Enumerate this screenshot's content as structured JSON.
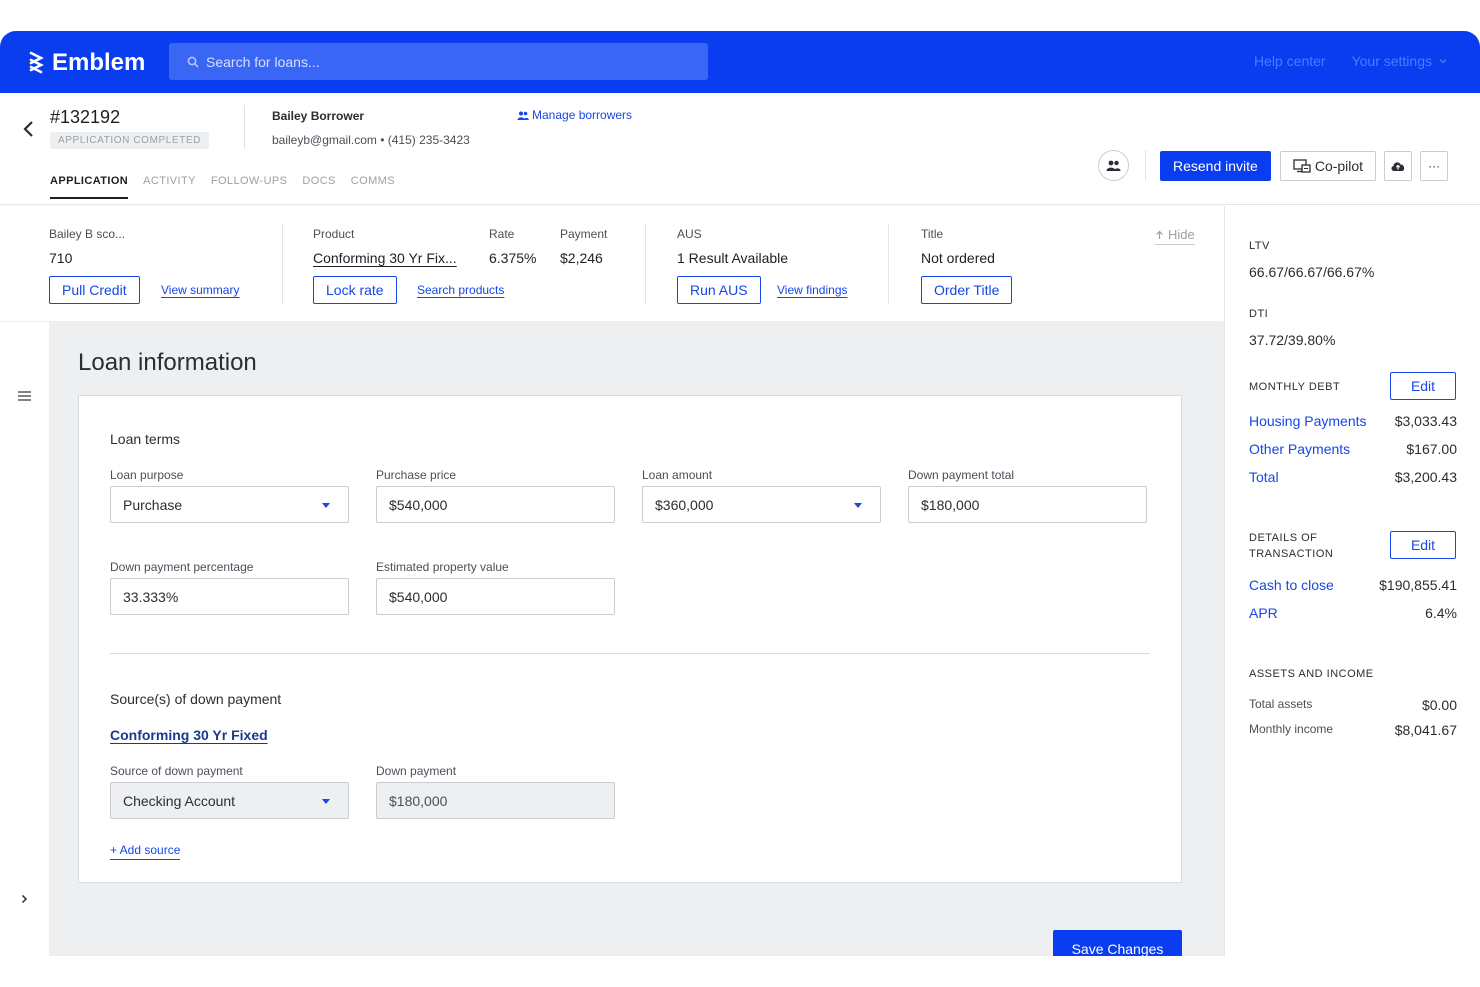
{
  "topbar": {
    "brand": "Emblem",
    "search_placeholder": "Search for loans...",
    "help_center": "Help center",
    "your_settings": "Your settings"
  },
  "header": {
    "loan_id": "#132192",
    "status": "APPLICATION COMPLETED",
    "borrower_name": "Bailey Borrower",
    "borrower_contact": "baileyb@gmail.com • (415) 235-3423",
    "manage_borrowers": "Manage borrowers",
    "tabs": [
      "APPLICATION",
      "ACTIVITY",
      "FOLLOW-UPS",
      "DOCS",
      "COMMS"
    ],
    "resend_invite": "Resend invite",
    "copilot": "Co-pilot",
    "more": "···"
  },
  "summary": {
    "credit": {
      "label": "Bailey B sco...",
      "value": "710",
      "button": "Pull Credit",
      "link": "View summary"
    },
    "product": {
      "label": "Product",
      "value": "Conforming 30 Yr Fix...",
      "button": "Lock rate",
      "link": "Search products"
    },
    "rate": {
      "label": "Rate",
      "value": "6.375%"
    },
    "payment": {
      "label": "Payment",
      "value": "$2,246"
    },
    "aus": {
      "label": "AUS",
      "value": "1 Result Available",
      "button": "Run AUS",
      "link": "View findings"
    },
    "title": {
      "label": "Title",
      "value": "Not ordered",
      "button": "Order Title"
    },
    "hide": "Hide"
  },
  "main": {
    "page_title": "Loan information",
    "loan_terms": {
      "title": "Loan terms",
      "loan_purpose": {
        "label": "Loan purpose",
        "value": "Purchase"
      },
      "purchase_price": {
        "label": "Purchase price",
        "value": "$540,000"
      },
      "loan_amount": {
        "label": "Loan amount",
        "value": "$360,000"
      },
      "down_payment_total": {
        "label": "Down payment total",
        "value": "$180,000"
      },
      "down_payment_pct": {
        "label": "Down payment percentage",
        "value": "33.333%"
      },
      "est_property_value": {
        "label": "Estimated property value",
        "value": "$540,000"
      }
    },
    "sources": {
      "title": "Source(s) of down payment",
      "product_link": "Conforming 30 Yr Fixed",
      "source": {
        "label": "Source of down payment",
        "value": "Checking Account"
      },
      "down_payment": {
        "label": "Down payment",
        "value": "$180,000"
      },
      "add_source": "+ Add source"
    },
    "save": "Save Changes"
  },
  "right_panel": {
    "ltv": {
      "label": "LTV",
      "value": "66.67/66.67/66.67%"
    },
    "dti": {
      "label": "DTI",
      "value": "37.72/39.80%"
    },
    "monthly_debt": {
      "label": "MONTHLY DEBT",
      "edit": "Edit",
      "rows": [
        {
          "k": "Housing Payments",
          "v": "$3,033.43"
        },
        {
          "k": "Other Payments",
          "v": "$167.00"
        },
        {
          "k": "Total",
          "v": "$3,200.43"
        }
      ]
    },
    "transaction": {
      "label_line1": "DETAILS OF",
      "label_line2": "TRANSACTION",
      "edit": "Edit",
      "rows": [
        {
          "k": "Cash to close",
          "v": "$190,855.41"
        },
        {
          "k": "APR",
          "v": "6.4%"
        }
      ]
    },
    "assets": {
      "label": "ASSETS AND INCOME",
      "rows": [
        {
          "k": "Total assets",
          "v": "$0.00"
        },
        {
          "k": "Monthly income",
          "v": "$8,041.67"
        }
      ]
    }
  },
  "colors": {
    "brand_blue": "#0a3cf0",
    "link_blue": "#1747e6"
  }
}
